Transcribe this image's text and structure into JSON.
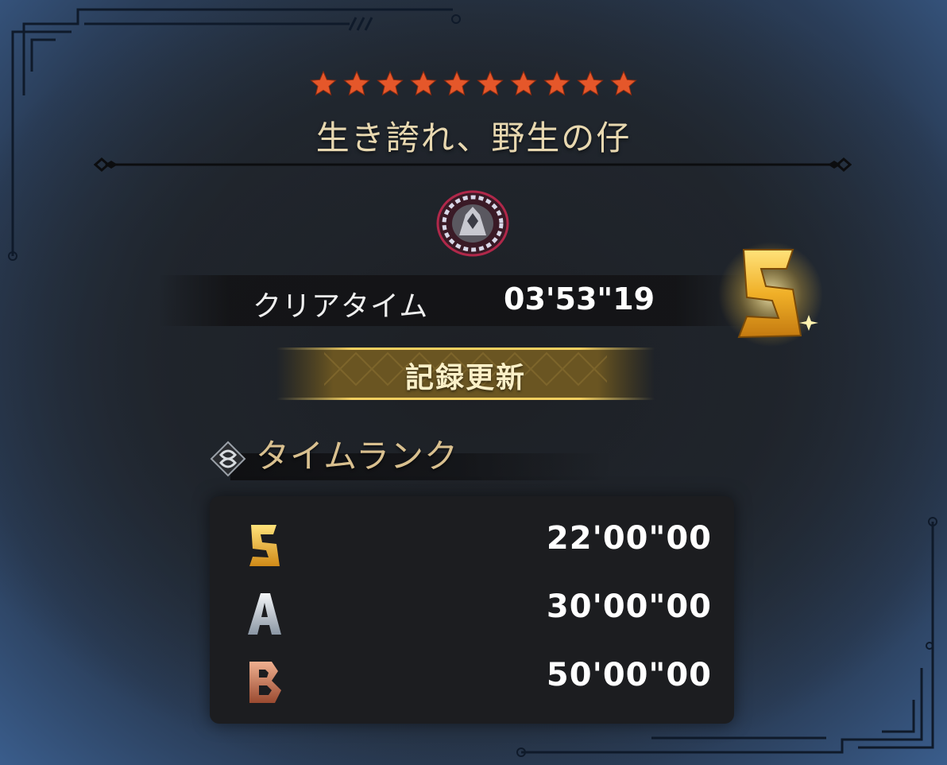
{
  "stage": {
    "stars": 10,
    "title": "生き誇れ、野生の仔"
  },
  "result": {
    "clear_label": "クリアタイム",
    "clear_time": "03'53\"19",
    "rank": "S",
    "record_badge": "記録更新"
  },
  "time_rank": {
    "heading": "タイムランク",
    "rows": [
      {
        "rank": "S",
        "time": "22'00\"00"
      },
      {
        "rank": "A",
        "time": "30'00\"00"
      },
      {
        "rank": "B",
        "time": "50'00\"00"
      }
    ]
  },
  "colors": {
    "star": "#e5572a",
    "gold": "#f0c040",
    "title": "#e8d8b0"
  }
}
